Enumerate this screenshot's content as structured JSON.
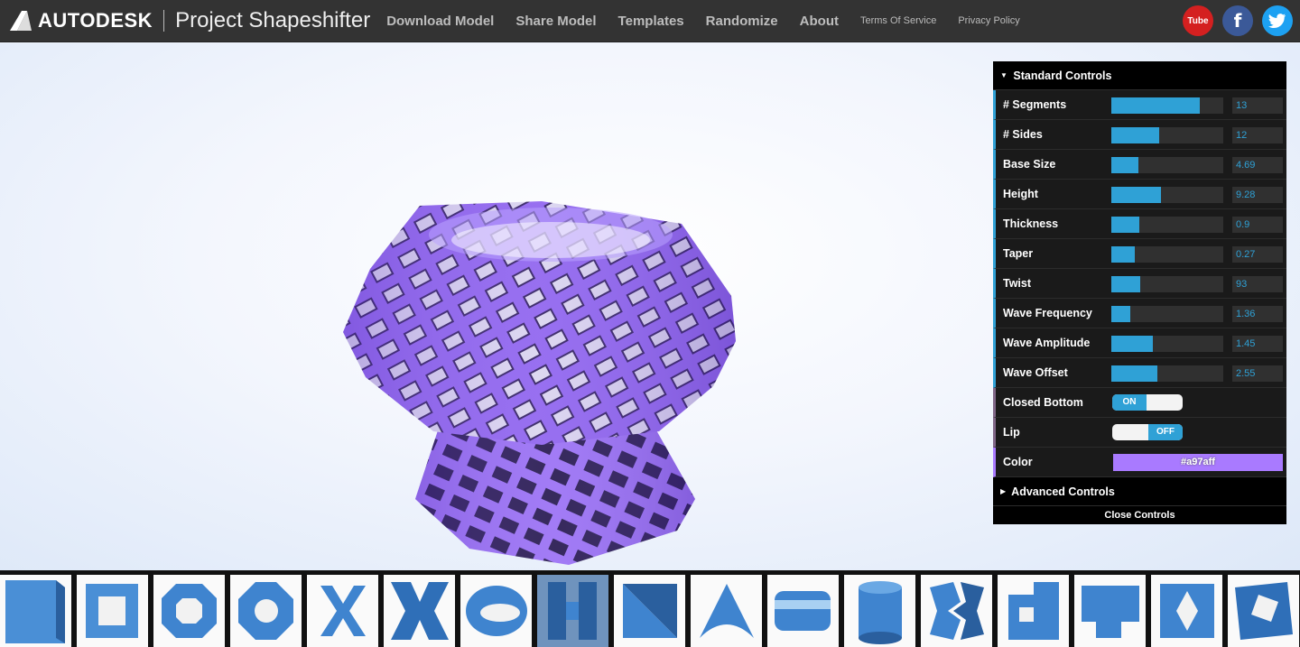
{
  "header": {
    "brand": "AUTODESK",
    "product": "Project Shapeshifter",
    "nav": [
      "Download Model",
      "Share Model",
      "Templates",
      "Randomize",
      "About"
    ],
    "legal": [
      "Terms Of Service",
      "Privacy Policy"
    ],
    "social": {
      "youtube": "Tube",
      "facebook": "f",
      "twitter": "twitter-bird-icon"
    }
  },
  "controls": {
    "standard_title": "Standard Controls",
    "sliders": [
      {
        "label": "# Segments",
        "value": "13",
        "fill": 0.79
      },
      {
        "label": "# Sides",
        "value": "12",
        "fill": 0.43
      },
      {
        "label": "Base Size",
        "value": "4.69",
        "fill": 0.24
      },
      {
        "label": "Height",
        "value": "9.28",
        "fill": 0.44
      },
      {
        "label": "Thickness",
        "value": "0.9",
        "fill": 0.25
      },
      {
        "label": "Taper",
        "value": "0.27",
        "fill": 0.21
      },
      {
        "label": "Twist",
        "value": "93",
        "fill": 0.26
      },
      {
        "label": "Wave Frequency",
        "value": "1.36",
        "fill": 0.17
      },
      {
        "label": "Wave Amplitude",
        "value": "1.45",
        "fill": 0.37
      },
      {
        "label": "Wave Offset",
        "value": "2.55",
        "fill": 0.41
      }
    ],
    "closed_bottom": {
      "label": "Closed Bottom",
      "state": "ON"
    },
    "lip": {
      "label": "Lip",
      "state": "OFF"
    },
    "color": {
      "label": "Color",
      "value": "#a97aff"
    },
    "advanced_title": "Advanced Controls",
    "close_label": "Close Controls"
  },
  "model_color": "#9a6ff5",
  "templates": {
    "count": 17,
    "active_index": 7
  }
}
